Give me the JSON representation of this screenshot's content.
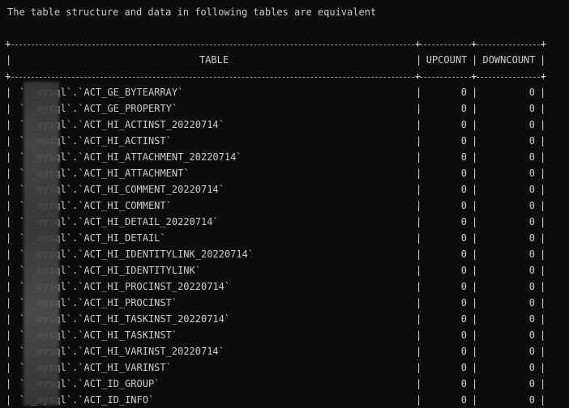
{
  "message": "The table structure and data in following tables are equivalent",
  "table": {
    "headers": [
      "TABLE",
      "UPCOUNT",
      "DOWNCOUNT"
    ],
    "rows": [
      {
        "name": "` _mysql`.`ACT_GE_BYTEARRAY`",
        "up": "0",
        "down": "0"
      },
      {
        "name": "` _mysql`.`ACT_GE_PROPERTY`",
        "up": "0",
        "down": "0"
      },
      {
        "name": "` _mysql`.`ACT_HI_ACTINST_20220714`",
        "up": "0",
        "down": "0"
      },
      {
        "name": "` _mysql`.`ACT_HI_ACTINST`",
        "up": "0",
        "down": "0"
      },
      {
        "name": "` _mysql`.`ACT_HI_ATTACHMENT_20220714`",
        "up": "0",
        "down": "0"
      },
      {
        "name": "` _mysql`.`ACT_HI_ATTACHMENT`",
        "up": "0",
        "down": "0"
      },
      {
        "name": "` _mysql`.`ACT_HI_COMMENT_20220714`",
        "up": "0",
        "down": "0"
      },
      {
        "name": "` _mysql`.`ACT_HI_COMMENT`",
        "up": "0",
        "down": "0"
      },
      {
        "name": "` _mysql`.`ACT_HI_DETAIL_20220714`",
        "up": "0",
        "down": "0"
      },
      {
        "name": "` _mysql`.`ACT_HI_DETAIL`",
        "up": "0",
        "down": "0"
      },
      {
        "name": "` _mysql`.`ACT_HI_IDENTITYLINK_20220714`",
        "up": "0",
        "down": "0"
      },
      {
        "name": "` _mysql`.`ACT_HI_IDENTITYLINK`",
        "up": "0",
        "down": "0"
      },
      {
        "name": "` _mysql`.`ACT_HI_PROCINST_20220714`",
        "up": "0",
        "down": "0"
      },
      {
        "name": "` _mysql`.`ACT_HI_PROCINST`",
        "up": "0",
        "down": "0"
      },
      {
        "name": "` _mysql`.`ACT_HI_TASKINST_20220714`",
        "up": "0",
        "down": "0"
      },
      {
        "name": "` _mysql`.`ACT_HI_TASKINST`",
        "up": "0",
        "down": "0"
      },
      {
        "name": "` _mysql`.`ACT_HI_VARINST_20220714`",
        "up": "0",
        "down": "0"
      },
      {
        "name": "` _mysql`.`ACT_HI_VARINST`",
        "up": "0",
        "down": "0"
      },
      {
        "name": "` _mysql`.`ACT_ID_GROUP`",
        "up": "0",
        "down": "0"
      },
      {
        "name": "` _mysql`.`ACT_ID_INFO`",
        "up": "0",
        "down": "0"
      }
    ]
  }
}
